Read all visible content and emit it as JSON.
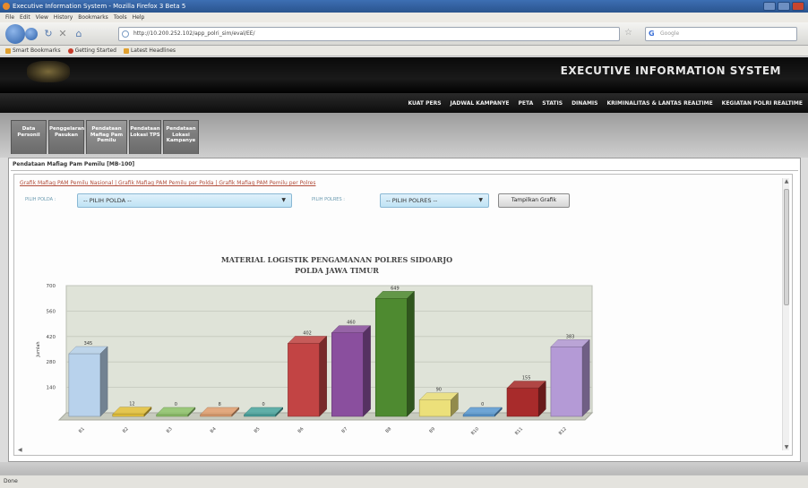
{
  "window": {
    "title": "Executive Information System - Mozilla Firefox 3 Beta 5"
  },
  "menubar": [
    "File",
    "Edit",
    "View",
    "History",
    "Bookmarks",
    "Tools",
    "Help"
  ],
  "browser": {
    "url": "http://10.200.252.102/app_polri_sim/eval/EE/",
    "search_placeholder": "Google"
  },
  "bookmarks": [
    "Smart Bookmarks",
    "Getting Started",
    "Latest Headlines"
  ],
  "header": {
    "title": "EXECUTIVE INFORMATION SYSTEM"
  },
  "topmenu": [
    "KUAT PERS",
    "JADWAL KAMPANYE",
    "PETA",
    "STATIS",
    "DINAMIS",
    "KRIMINALITAS & LANTAS REALTIME",
    "KEGIATAN POLRI REALTIME"
  ],
  "tabs": [
    {
      "label": "Data Personil"
    },
    {
      "label": "Penggelaran Pasukan"
    },
    {
      "label": "Pendataan Mafiag Pam Pemilu"
    },
    {
      "label": "Pendataan Lokasi TPS"
    },
    {
      "label": "Pendataan Lokasi Kampanye"
    }
  ],
  "section": {
    "title": "Pendataan Mafiag Pam Pemilu [MB-100]",
    "links": "Grafik Mafiag PAM Pemilu Nasional | Grafik Mafiag PAM Pemilu per Polda | Grafik Mafiag PAM Pemilu per Polres"
  },
  "filters": {
    "polda_label": "PILIH POLDA :",
    "polda_value": "-- PILIH POLDA --",
    "polres_label": "PILIH POLRES :",
    "polres_value": "-- PILIH POLRES --",
    "button_label": "Tampilkan Grafik"
  },
  "chart_title_1": "MATERIAL LOGISTIK PENGAMANAN POLRES SIDOARJO",
  "chart_title_2": "POLDA JAWA TIMUR",
  "status": "Done",
  "chart_data": {
    "type": "bar",
    "title": "MATERIAL LOGISTIK PENGAMANAN POLRES SIDOARJO",
    "subtitle": "POLDA JAWA TIMUR",
    "ylabel": "Jumlah",
    "ylim": [
      0,
      700
    ],
    "yticks": [
      140,
      280,
      420,
      560,
      700
    ],
    "categories": [
      "B1",
      "B2",
      "B3",
      "B4",
      "B5",
      "B6",
      "B7",
      "B8",
      "B9",
      "B10",
      "B11",
      "B12"
    ],
    "values": [
      345,
      12,
      0,
      8,
      0,
      402,
      460,
      649,
      90,
      0,
      155,
      383
    ],
    "colors": [
      "#b8d2ec",
      "#e5c23a",
      "#8fc46a",
      "#e3a070",
      "#4aa6a0",
      "#c24444",
      "#8a4f9e",
      "#4e8a30",
      "#ece07a",
      "#5b9bd5",
      "#a82b2b",
      "#b49ad6"
    ],
    "grid": true
  }
}
